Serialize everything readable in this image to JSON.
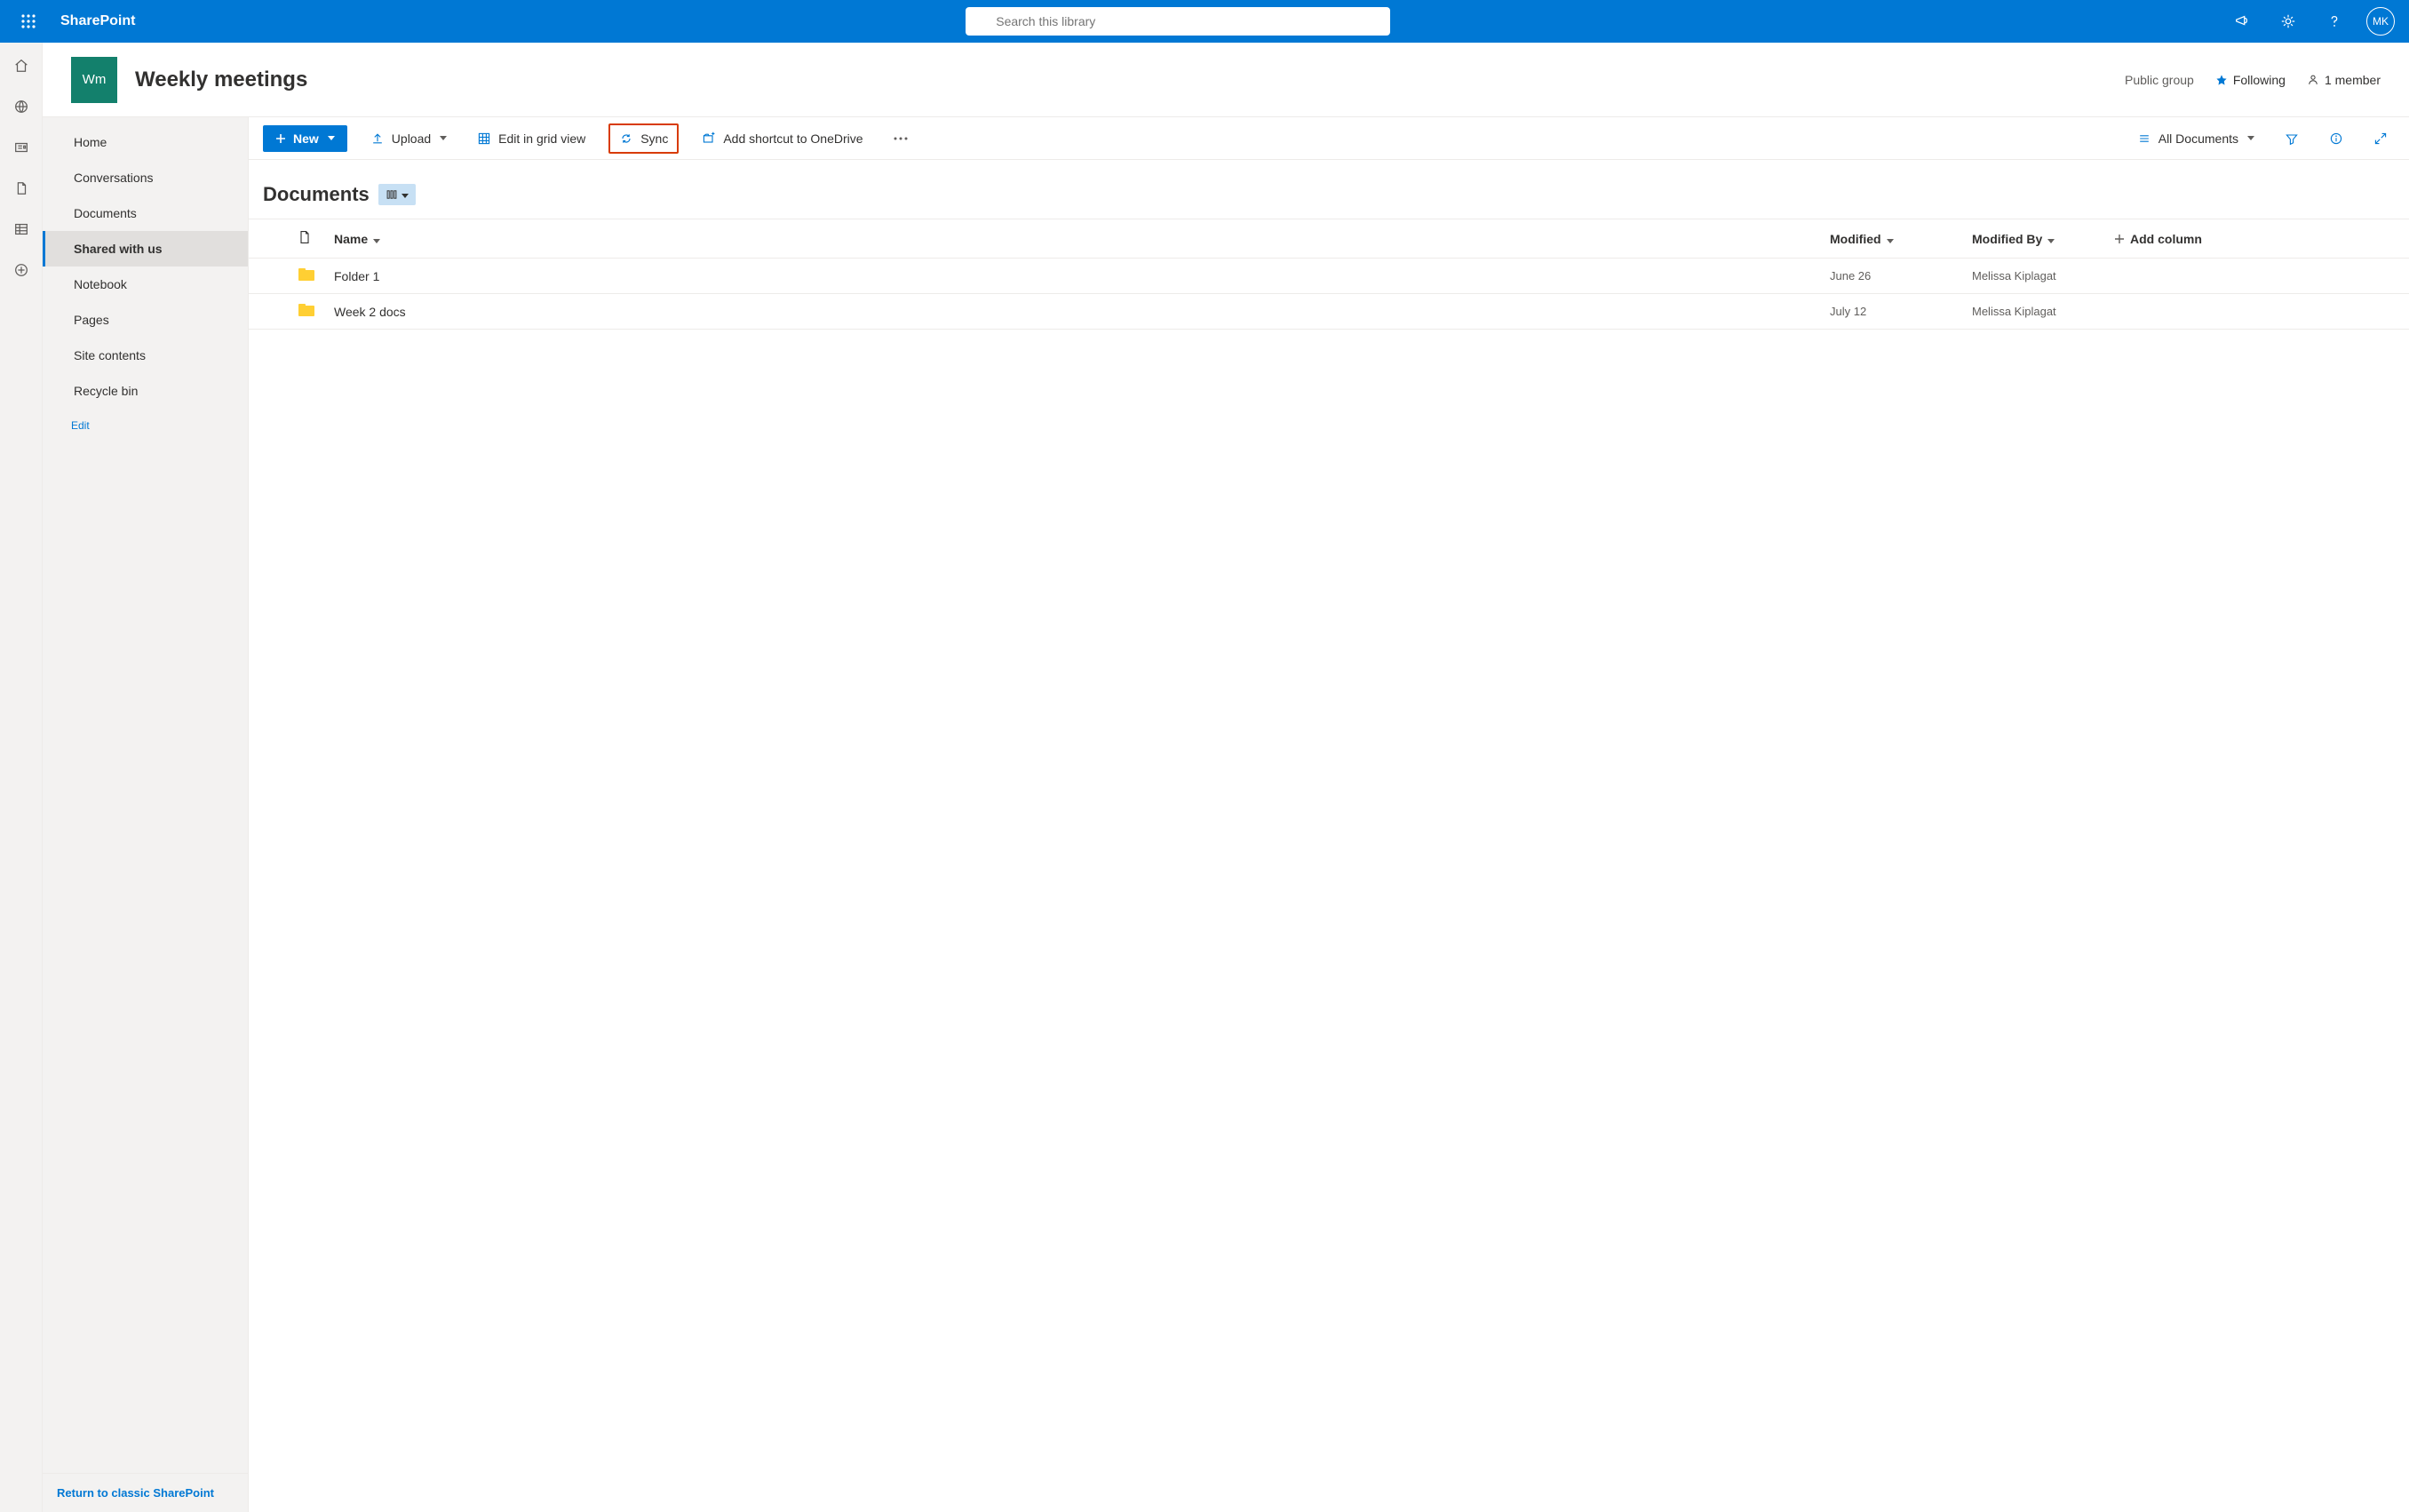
{
  "suite": {
    "app_name": "SharePoint",
    "search_placeholder": "Search this library",
    "avatar_initials": "MK"
  },
  "site": {
    "logo_text": "Wm",
    "title": "Weekly meetings",
    "visibility": "Public group",
    "follow_label": "Following",
    "members_label": "1 member"
  },
  "nav": {
    "items": [
      {
        "label": "Home"
      },
      {
        "label": "Conversations"
      },
      {
        "label": "Documents"
      },
      {
        "label": "Shared with us"
      },
      {
        "label": "Notebook"
      },
      {
        "label": "Pages"
      },
      {
        "label": "Site contents"
      },
      {
        "label": "Recycle bin"
      }
    ],
    "active_index": 3,
    "edit_label": "Edit",
    "classic_link": "Return to classic SharePoint"
  },
  "command_bar": {
    "new_label": "New",
    "upload_label": "Upload",
    "grid_label": "Edit in grid view",
    "sync_label": "Sync",
    "shortcut_label": "Add shortcut to OneDrive",
    "view_label": "All Documents"
  },
  "library": {
    "title": "Documents",
    "columns": {
      "name": "Name",
      "modified": "Modified",
      "modified_by": "Modified By",
      "add": "Add column"
    },
    "rows": [
      {
        "name": "Folder 1",
        "modified": "June 26",
        "modified_by": "Melissa Kiplagat"
      },
      {
        "name": "Week 2 docs",
        "modified": "July 12",
        "modified_by": "Melissa Kiplagat"
      }
    ]
  }
}
